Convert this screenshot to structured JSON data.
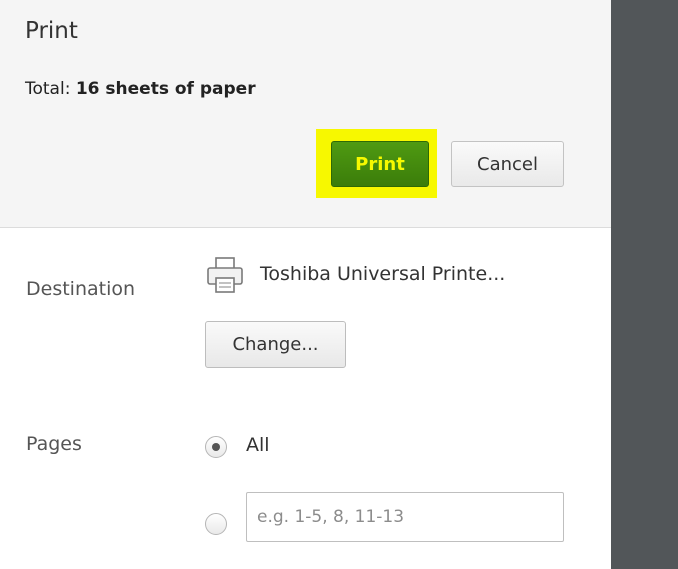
{
  "header": {
    "title": "Print",
    "total_prefix": "Total: ",
    "total_value": "16 sheets of paper",
    "print_label": "Print",
    "cancel_label": "Cancel",
    "highlight_color": "#f7f800",
    "print_button_color": "#3f8a0c"
  },
  "destination": {
    "label": "Destination",
    "printer_name": "Toshiba Universal Printe...",
    "printer_icon": "printer-icon",
    "change_label": "Change..."
  },
  "pages": {
    "label": "Pages",
    "option_all": "All",
    "all_selected": true,
    "custom_placeholder": "e.g. 1-5, 8, 11-13",
    "custom_value": ""
  }
}
